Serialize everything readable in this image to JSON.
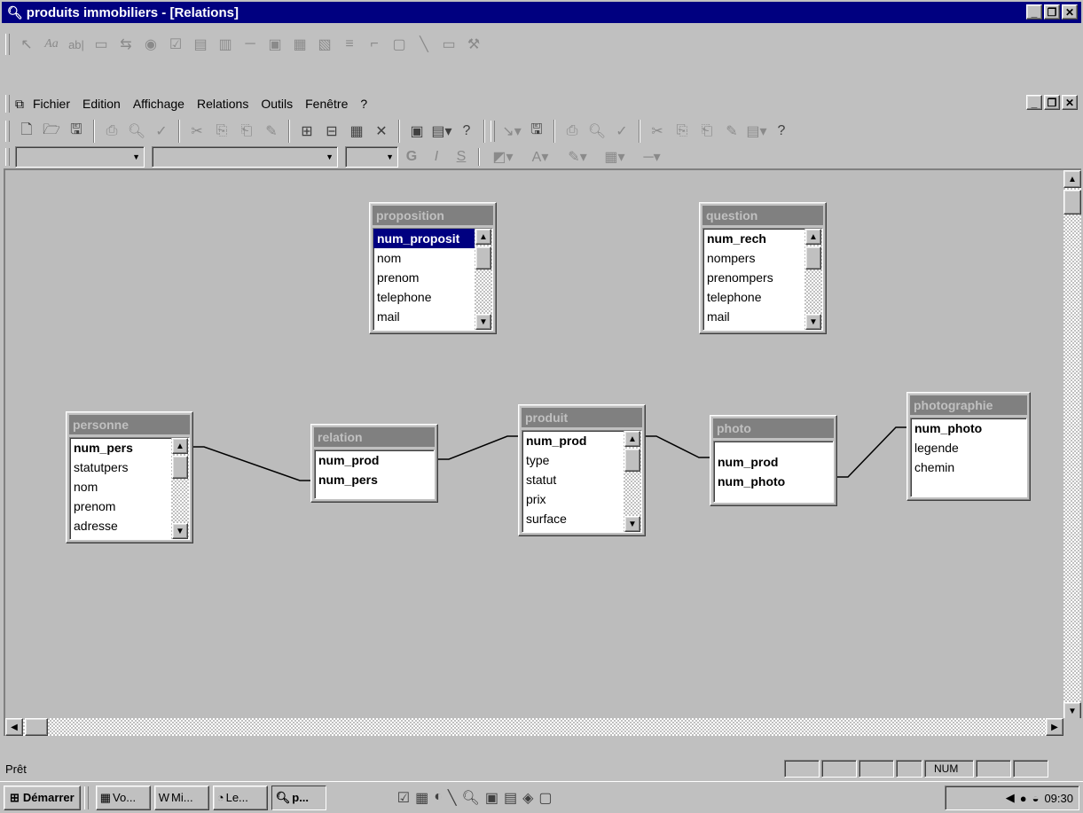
{
  "window": {
    "title": "produits immobiliers - [Relations]"
  },
  "menu": [
    "Fichier",
    "Edition",
    "Affichage",
    "Relations",
    "Outils",
    "Fenêtre",
    "?"
  ],
  "status": {
    "text": "Prêt",
    "num": "NUM"
  },
  "tables": {
    "proposition": {
      "title": "proposition",
      "fields": [
        "num_proposit",
        "nom",
        "prenom",
        "telephone",
        "mail"
      ]
    },
    "question": {
      "title": "question",
      "fields": [
        "num_rech",
        "nompers",
        "prenompers",
        "telephone",
        "mail"
      ]
    },
    "personne": {
      "title": "personne",
      "fields": [
        "num_pers",
        "statutpers",
        "nom",
        "prenom",
        "adresse"
      ]
    },
    "relation": {
      "title": "relation",
      "fields": [
        "num_prod",
        "num_pers"
      ]
    },
    "produit": {
      "title": "produit",
      "fields": [
        "num_prod",
        "type",
        "statut",
        "prix",
        "surface"
      ]
    },
    "photo": {
      "title": "photo",
      "fields": [
        "num_prod",
        "num_photo"
      ]
    },
    "photographie": {
      "title": "photographie",
      "fields": [
        "num_photo",
        "legende",
        "chemin"
      ]
    }
  },
  "taskbar": {
    "start": "Démarrer",
    "buttons": [
      "Vo...",
      "Mi...",
      "Le...",
      "p..."
    ],
    "clock": "09:30"
  },
  "icons": {
    "app": "magnifier-icon",
    "doc": "relations-icon",
    "toolbox": [
      "pointer",
      "label",
      "textbox",
      "frame",
      "toggle",
      "option",
      "checkbox",
      "combo",
      "list",
      "button",
      "image",
      "object",
      "bound-object",
      "page-break",
      "tab",
      "subform",
      "line",
      "rectangle",
      "more"
    ],
    "main": [
      "new",
      "open",
      "save",
      "print",
      "preview",
      "spell",
      "cut",
      "copy",
      "paste",
      "format-painter",
      "show-table",
      "show-direct",
      "show-all",
      "delete",
      "database-window",
      "new-object",
      "help"
    ],
    "format": [
      "bold",
      "italic",
      "underline",
      "fill-color",
      "font-color",
      "line-color",
      "border",
      "line-width"
    ]
  }
}
